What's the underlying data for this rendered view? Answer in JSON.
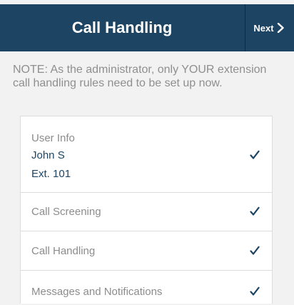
{
  "header": {
    "title": "Call Handling",
    "next_label": "Next",
    "next_icon": "chevron-right-icon",
    "background": "#1d4563"
  },
  "note": "NOTE: As the administrator, only YOUR extension call handling rules need to be set up now.",
  "settings": {
    "user_info": {
      "label": "User Info",
      "name": "John S",
      "extension": "Ext. 101",
      "checked": true
    },
    "rows": [
      {
        "label": "Call Screening",
        "checked": true
      },
      {
        "label": "Call Handling",
        "checked": true
      },
      {
        "label": "Messages and Notifications",
        "checked": true
      }
    ],
    "check_icon": "checkmark-icon",
    "text_color": "#8c8c8c",
    "accent_color": "#1d4563"
  }
}
